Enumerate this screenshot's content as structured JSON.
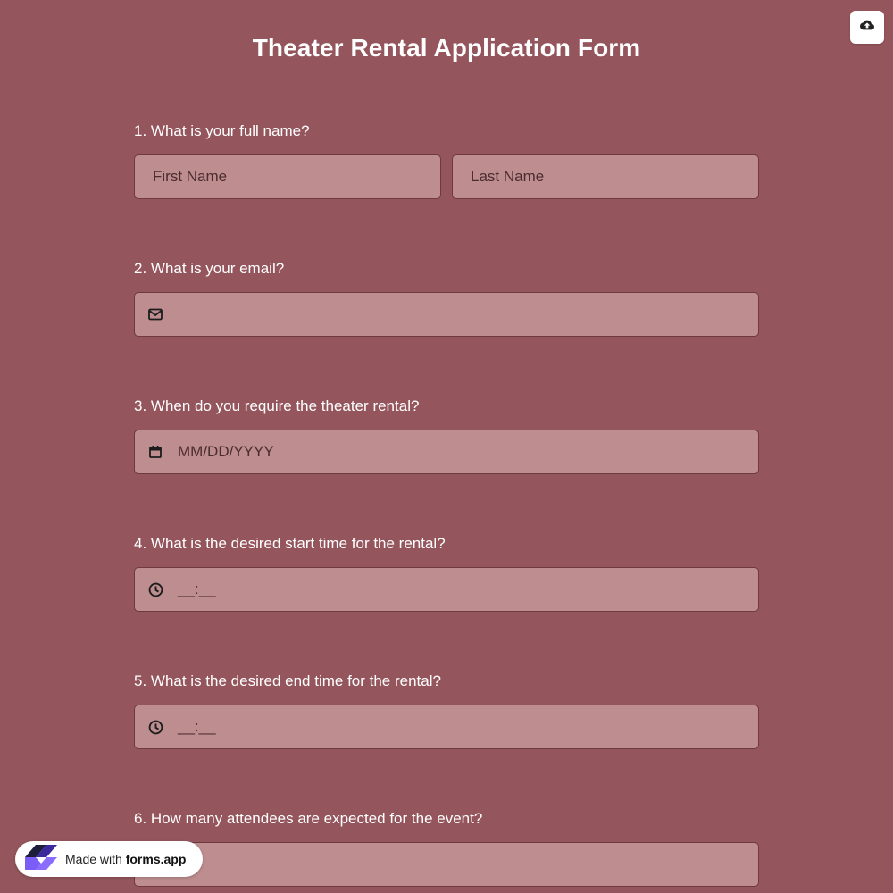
{
  "form": {
    "title": "Theater Rental Application Form"
  },
  "toolbar": {
    "upload_icon": "cloud-upload-icon"
  },
  "questions": [
    {
      "label": "1.  What is your full name?",
      "first_name_placeholder": "First Name",
      "last_name_placeholder": "Last Name"
    },
    {
      "label": "2. What is your email?",
      "icon": "mail-icon",
      "value": ""
    },
    {
      "label": "3. When do you require the theater rental?",
      "icon": "calendar-icon",
      "placeholder": "MM/DD/YYYY"
    },
    {
      "label": "4. What is the desired start time for the rental?",
      "icon": "clock-icon",
      "placeholder": "__:__"
    },
    {
      "label": "5. What is the desired end time for the rental?",
      "icon": "clock-icon",
      "placeholder": "__:__"
    },
    {
      "label": "6. How many attendees are expected for the event?",
      "value": ""
    }
  ],
  "badge": {
    "prefix": "Made with",
    "brand": "forms.app",
    "logo_icon": "forms-app-logo-icon"
  },
  "colors": {
    "background": "#94555c",
    "field_bg": "#bd8d8f",
    "field_border": "#6e3a40",
    "text": "#ffffff",
    "badge_logo_purple": "#6b4cf6"
  }
}
